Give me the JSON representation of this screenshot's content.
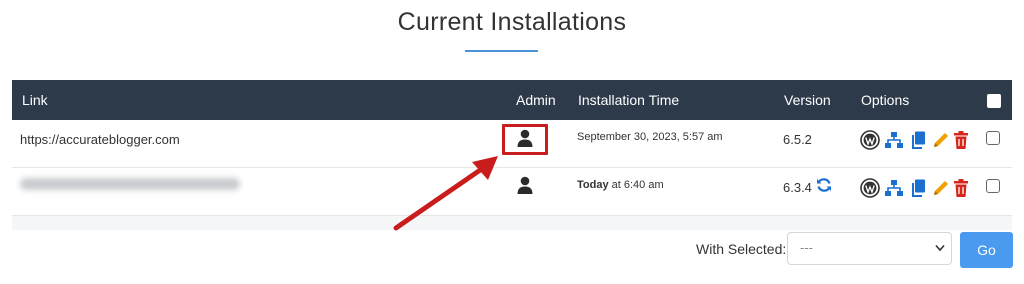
{
  "header": {
    "title": "Current Installations"
  },
  "table": {
    "columns": {
      "link": "Link",
      "admin": "Admin",
      "time": "Installation Time",
      "version": "Version",
      "options": "Options"
    },
    "rows": [
      {
        "link": "https://accurateblogger.com",
        "time": "September 30, 2023, 5:57 am",
        "version": "6.5.2"
      },
      {
        "link": "",
        "time_bold": "Today",
        "time_rest": " at 6:40 am",
        "version": "6.3.4"
      }
    ]
  },
  "footer": {
    "with_selected_label": "With Selected:",
    "select_value": "---",
    "go_label": "Go"
  },
  "colors": {
    "header_bg": "#2d3a4a",
    "accent_blue": "#4a90d9",
    "highlight_red": "#c91d1d",
    "icon_blue": "#1a6fd0",
    "icon_orange": "#f0a000",
    "icon_red": "#d9261c"
  }
}
